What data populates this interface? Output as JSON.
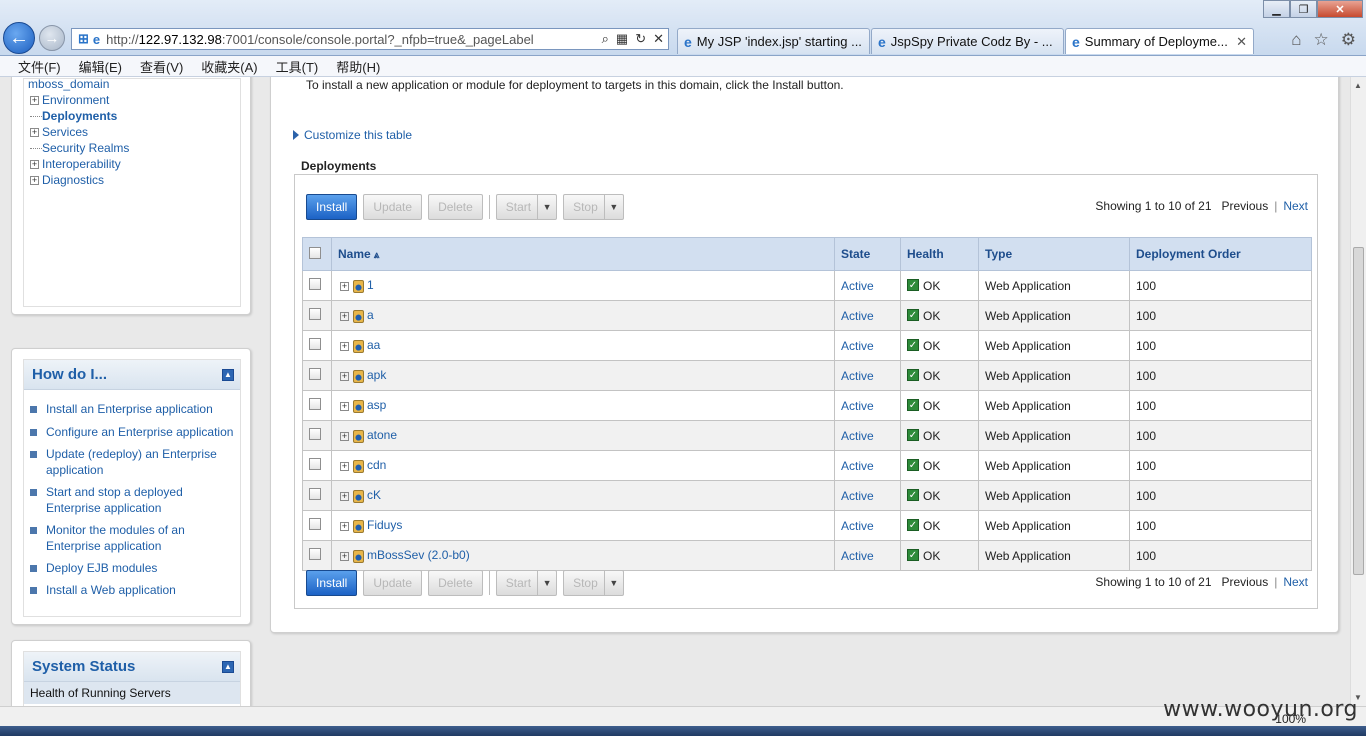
{
  "browser": {
    "address_prefix": "http://",
    "address_host": "122.97.132.98",
    "address_rest": ":7001/console/console.portal?_nfpb=true&_pageLabel",
    "tabs": [
      {
        "label": "My JSP 'index.jsp' starting ..."
      },
      {
        "label": "JspSpy Private Codz By - ..."
      },
      {
        "label": "Summary of Deployme..."
      }
    ],
    "menu": [
      "文件(F)",
      "编辑(E)",
      "查看(V)",
      "收藏夹(A)",
      "工具(T)",
      "帮助(H)"
    ],
    "zoom": "100%"
  },
  "sidebar": {
    "domain_name": "mboss_domain",
    "tree": [
      {
        "label": "Environment",
        "expandable": true
      },
      {
        "label": "Deployments",
        "expandable": false,
        "selected": true
      },
      {
        "label": "Services",
        "expandable": true
      },
      {
        "label": "Security Realms",
        "expandable": false
      },
      {
        "label": "Interoperability",
        "expandable": true
      },
      {
        "label": "Diagnostics",
        "expandable": true
      }
    ],
    "howdoi": {
      "title": "How do I...",
      "items": [
        "Install an Enterprise application",
        "Configure an Enterprise application",
        "Update (redeploy) an Enterprise application",
        "Start and stop a deployed Enterprise application",
        "Monitor the modules of an Enterprise application",
        "Deploy EJB modules",
        "Install a Web application"
      ]
    },
    "system_status": {
      "title": "System Status",
      "subtitle": "Health of Running Servers"
    }
  },
  "main": {
    "intro": "To install a new application or module for deployment to targets in this domain, click the Install button.",
    "customize": "Customize this table",
    "section_title": "Deployments",
    "buttons": {
      "install": "Install",
      "update": "Update",
      "delete": "Delete",
      "start": "Start",
      "stop": "Stop"
    },
    "pager": {
      "showing": "Showing 1 to 10 of 21",
      "previous": "Previous",
      "separator": "|",
      "next": "Next"
    },
    "columns": [
      "Name",
      "State",
      "Health",
      "Type",
      "Deployment Order"
    ],
    "rows": [
      {
        "name": "1",
        "state": "Active",
        "health": "OK",
        "type": "Web Application",
        "order": "100"
      },
      {
        "name": "a",
        "state": "Active",
        "health": "OK",
        "type": "Web Application",
        "order": "100"
      },
      {
        "name": "aa",
        "state": "Active",
        "health": "OK",
        "type": "Web Application",
        "order": "100"
      },
      {
        "name": "apk",
        "state": "Active",
        "health": "OK",
        "type": "Web Application",
        "order": "100"
      },
      {
        "name": "asp",
        "state": "Active",
        "health": "OK",
        "type": "Web Application",
        "order": "100"
      },
      {
        "name": "atone",
        "state": "Active",
        "health": "OK",
        "type": "Web Application",
        "order": "100"
      },
      {
        "name": "cdn",
        "state": "Active",
        "health": "OK",
        "type": "Web Application",
        "order": "100"
      },
      {
        "name": "cK",
        "state": "Active",
        "health": "OK",
        "type": "Web Application",
        "order": "100"
      },
      {
        "name": "Fiduys",
        "state": "Active",
        "health": "OK",
        "type": "Web Application",
        "order": "100"
      },
      {
        "name": "mBossSev (2.0-b0)",
        "state": "Active",
        "health": "OK",
        "type": "Web Application",
        "order": "100"
      }
    ]
  },
  "watermark": "www.wooyun.org"
}
